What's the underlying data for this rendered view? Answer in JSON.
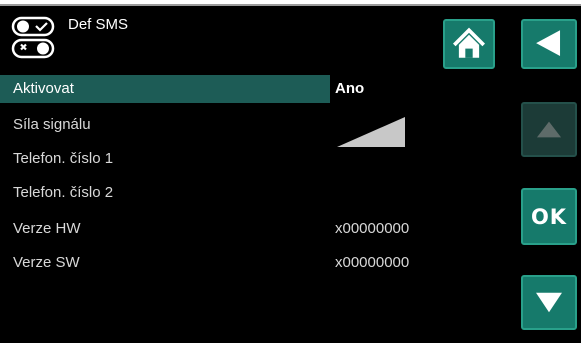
{
  "header": {
    "title": "Def SMS",
    "icon": "sms-toggle-icon"
  },
  "nav": {
    "home_icon": "home-icon",
    "back_icon": "back-arrow-icon",
    "up_icon": "up-arrow-icon",
    "down_icon": "down-arrow-icon",
    "ok_label": "OK"
  },
  "settings": [
    {
      "label": "Aktivovat",
      "value": "Ano",
      "selected": true
    },
    {
      "label": "Síla signálu",
      "value": "",
      "signal_icon": "signal-strength-icon"
    },
    {
      "label": "Telefon. číslo 1",
      "value": ""
    },
    {
      "label": "Telefon. číslo 2",
      "value": ""
    },
    {
      "label": "Verze HW",
      "value": "x00000000"
    },
    {
      "label": "Verze SW",
      "value": "x00000000"
    }
  ],
  "colors": {
    "accent": "#167a6b",
    "selected_row": "#1d5c56",
    "disabled_button": "#1c3b37",
    "background": "#000000"
  }
}
